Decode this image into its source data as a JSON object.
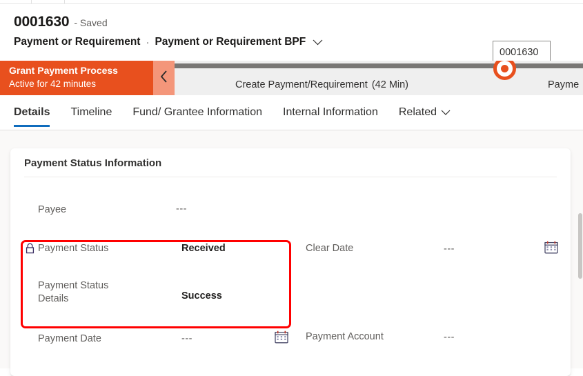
{
  "header": {
    "record_name": "0001630",
    "saved_state": "- Saved",
    "entity_name": "Payment or Requirement",
    "separator": "·",
    "process_name": "Payment or Requirement BPF",
    "process_chevron_icon": "chevron-down-icon",
    "right_field_value": "0001630"
  },
  "business_process_flow": {
    "name": "Grant Payment Process",
    "active_duration": "Active for 42 minutes",
    "back_button_icon": "chevron-left-icon",
    "stages": [
      {
        "label": "Create Payment/Requirement",
        "duration": "(42 Min)",
        "state": "active"
      },
      {
        "label": "Payme",
        "duration": "",
        "state": "upcoming"
      }
    ]
  },
  "tabs": [
    {
      "label": "Details",
      "active": true,
      "has_chevron": false
    },
    {
      "label": "Timeline",
      "active": false,
      "has_chevron": false
    },
    {
      "label": "Fund/ Grantee Information",
      "active": false,
      "has_chevron": false
    },
    {
      "label": "Internal Information",
      "active": false,
      "has_chevron": false
    },
    {
      "label": "Related",
      "active": false,
      "has_chevron": true
    }
  ],
  "section": {
    "title": "Payment Status Information"
  },
  "fields": {
    "payee": {
      "label": "Payee",
      "value": "---"
    },
    "payment_status": {
      "label": "Payment Status",
      "value": "Received",
      "lock_icon": "lock-icon"
    },
    "payment_status_details": {
      "label": "Payment Status Details",
      "value": "Success"
    },
    "clear_date": {
      "label": "Clear Date",
      "value": "---",
      "calendar_icon": "calendar-icon"
    },
    "payment_date": {
      "label": "Payment Date",
      "value": "---",
      "calendar_icon": "calendar-icon"
    },
    "payment_account": {
      "label": "Payment Account",
      "value": "---"
    }
  },
  "annotation": {
    "color": "#ff0000",
    "target": "payment-status-fields"
  },
  "colors": {
    "bpf_orange": "#e8501e",
    "bpf_back_orange": "#f4967a",
    "bpf_track_gray": "#797775",
    "tab_accent_blue": "#0f6cbd",
    "page_background": "#faf9f8",
    "annotation_red": "#ff0000"
  }
}
